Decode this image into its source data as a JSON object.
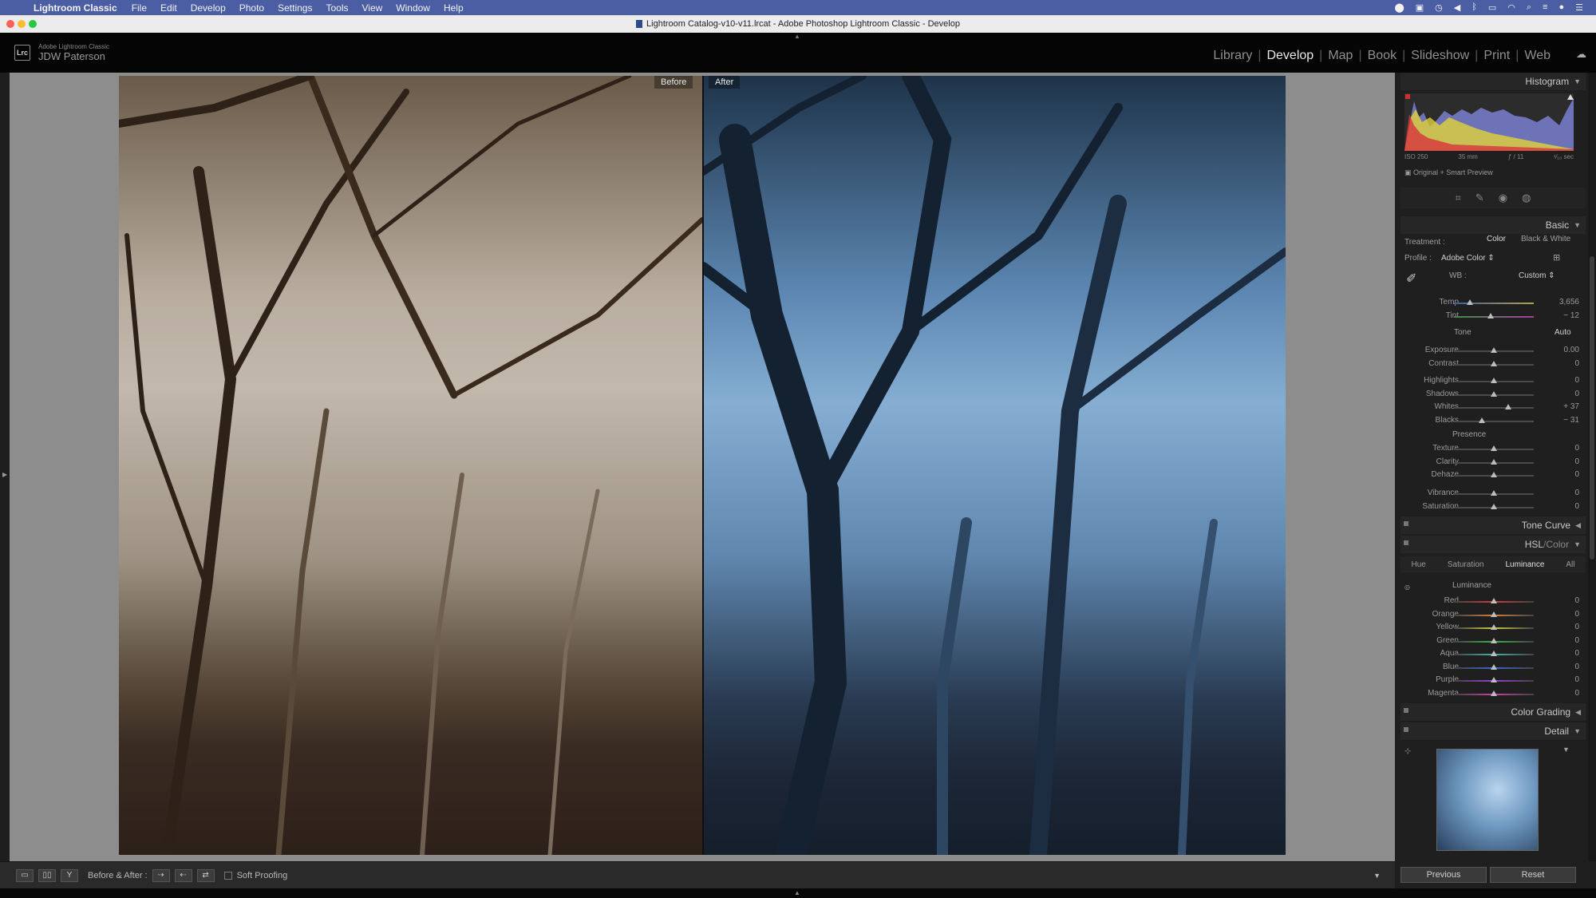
{
  "menubar": {
    "app_name": "Lightroom Classic",
    "menus": [
      "File",
      "Edit",
      "Develop",
      "Photo",
      "Settings",
      "Tools",
      "View",
      "Window",
      "Help"
    ]
  },
  "window": {
    "title": "Lightroom Catalog-v10-v11.lrcat - Adobe Photoshop Lightroom Classic - Develop"
  },
  "identity": {
    "badge": "Lrc",
    "product": "Adobe Lightroom Classic",
    "user": "JDW Paterson"
  },
  "modules": [
    "Library",
    "Develop",
    "Map",
    "Book",
    "Slideshow",
    "Print",
    "Web"
  ],
  "active_module": "Develop",
  "view": {
    "before_label": "Before",
    "after_label": "After"
  },
  "histogram": {
    "header": "Histogram",
    "iso": "ISO 250",
    "focal": "35 mm",
    "aperture": "ƒ / 11",
    "shutter": "¹⁄₁₀ sec",
    "preview_note": "Original + Smart Preview"
  },
  "basic": {
    "header": "Basic",
    "treatment_label": "Treatment :",
    "treatment_color": "Color",
    "treatment_bw": "Black & White",
    "profile_label": "Profile :",
    "profile_value": "Adobe Color",
    "wb_label": "WB :",
    "wb_value": "Custom",
    "temp": {
      "label": "Temp",
      "value": "3,656",
      "pos": 0.2
    },
    "tint": {
      "label": "Tint",
      "value": "− 12",
      "pos": 0.46
    },
    "tone_label": "Tone",
    "auto_label": "Auto",
    "tone": [
      {
        "label": "Exposure",
        "value": "0.00",
        "pos": 0.5
      },
      {
        "label": "Contrast",
        "value": "0",
        "pos": 0.5
      },
      {
        "label": "Highlights",
        "value": "0",
        "pos": 0.5
      },
      {
        "label": "Shadows",
        "value": "0",
        "pos": 0.5
      },
      {
        "label": "Whites",
        "value": "+ 37",
        "pos": 0.68
      },
      {
        "label": "Blacks",
        "value": "− 31",
        "pos": 0.35
      }
    ],
    "presence_label": "Presence",
    "presence": [
      {
        "label": "Texture",
        "value": "0",
        "pos": 0.5
      },
      {
        "label": "Clarity",
        "value": "0",
        "pos": 0.5
      },
      {
        "label": "Dehaze",
        "value": "0",
        "pos": 0.5
      },
      {
        "label": "Vibrance",
        "value": "0",
        "pos": 0.5
      },
      {
        "label": "Saturation",
        "value": "0",
        "pos": 0.5
      }
    ]
  },
  "tone_curve": {
    "header": "Tone Curve"
  },
  "hsl": {
    "header_hsl": "HSL",
    "header_sep": " / ",
    "header_color": "Color",
    "tabs": [
      "Hue",
      "Saturation",
      "Luminance",
      "All"
    ],
    "active_tab": "Luminance",
    "section_label": "Luminance",
    "rows": [
      {
        "label": "Red",
        "value": "0",
        "pos": 0.5
      },
      {
        "label": "Orange",
        "value": "0",
        "pos": 0.5
      },
      {
        "label": "Yellow",
        "value": "0",
        "pos": 0.5
      },
      {
        "label": "Green",
        "value": "0",
        "pos": 0.5
      },
      {
        "label": "Aqua",
        "value": "0",
        "pos": 0.5
      },
      {
        "label": "Blue",
        "value": "0",
        "pos": 0.5
      },
      {
        "label": "Purple",
        "value": "0",
        "pos": 0.5
      },
      {
        "label": "Magenta",
        "value": "0",
        "pos": 0.5
      }
    ]
  },
  "color_grading": {
    "header": "Color Grading"
  },
  "detail": {
    "header": "Detail"
  },
  "toolbar": {
    "before_after_label": "Before & After :",
    "soft_proofing": "Soft Proofing"
  },
  "buttons": {
    "previous": "Previous",
    "reset": "Reset"
  }
}
